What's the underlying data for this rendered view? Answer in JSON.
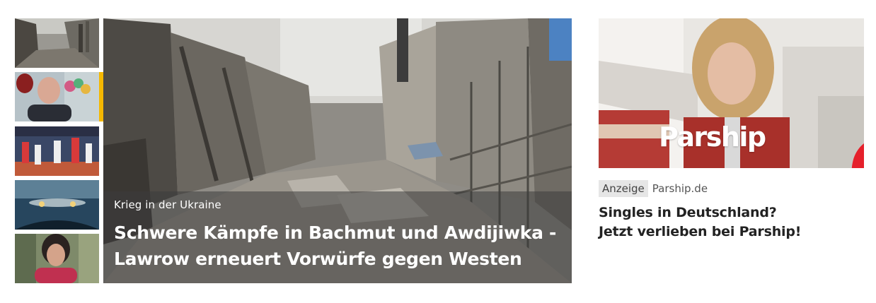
{
  "thumbnails": [
    {
      "icon": "destroyed-street-thumbnail"
    },
    {
      "icon": "man-portrait-thumbnail"
    },
    {
      "icon": "handball-game-thumbnail"
    },
    {
      "icon": "car-windshield-thumbnail"
    },
    {
      "icon": "woman-portrait-thumbnail"
    }
  ],
  "active_thumbnail": 1,
  "colors": {
    "active_marker": "#f5b800",
    "ad_heart": "#e5202b",
    "ad_jacket": "#a8302a"
  },
  "hero": {
    "kicker": "Krieg in der Ukraine",
    "headline": "Schwere Kämpfe in Bachmut und Awdijiwka - Lawrow erneuert Vorwürfe gegen Westen"
  },
  "ad": {
    "brand_logo": "Parship",
    "badge": "Anzeige",
    "domain": "Parship.de",
    "title_line1": "Singles in Deutschland?",
    "title_line2": "Jetzt verlieben bei Parship!"
  }
}
